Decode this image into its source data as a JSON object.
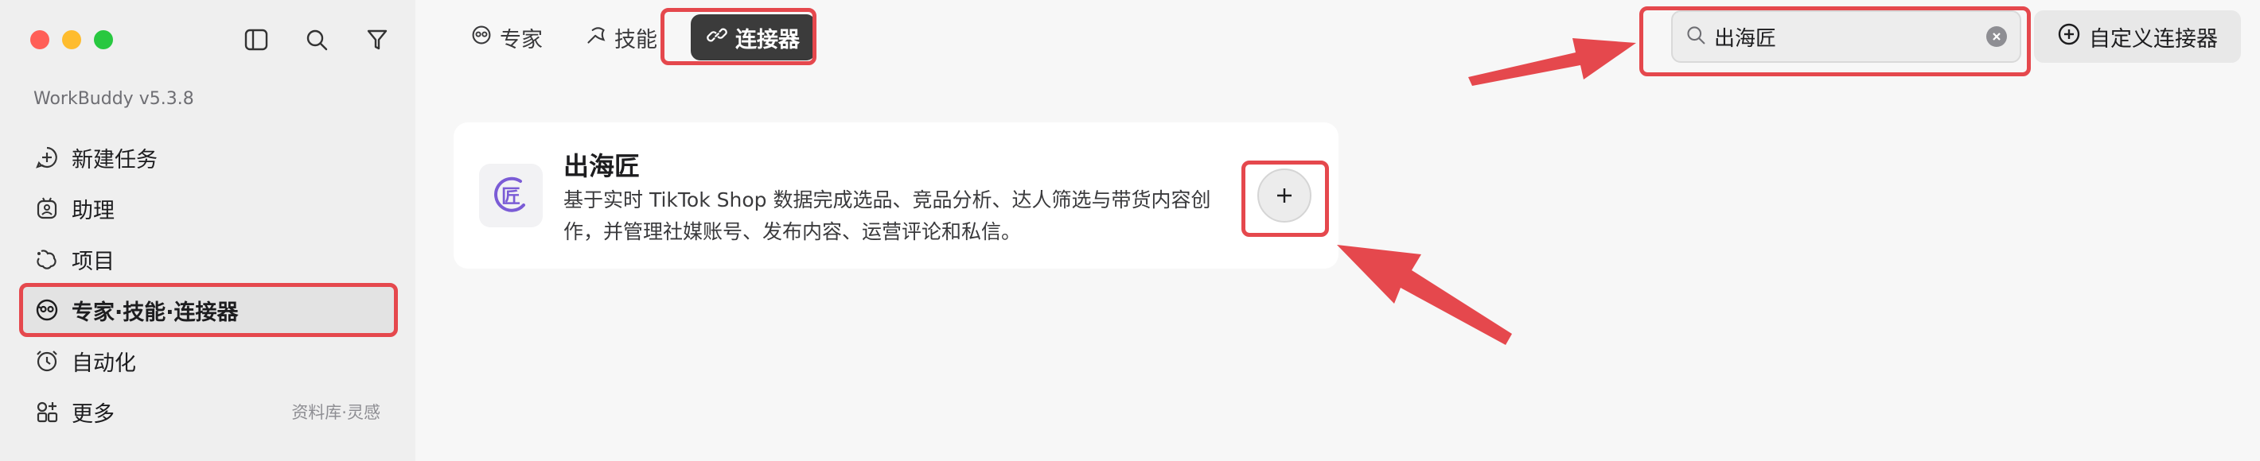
{
  "app": {
    "version": "WorkBuddy v5.3.8"
  },
  "window_controls": {
    "close": "#ff5f57",
    "minimize": "#febc2e",
    "zoom": "#28c840"
  },
  "sidebar": {
    "tools": [
      "sidebar-toggle-icon",
      "search-icon",
      "filter-icon"
    ],
    "items": [
      {
        "label": "新建任务",
        "icon": "new-task-icon"
      },
      {
        "label": "助理",
        "icon": "assistant-icon"
      },
      {
        "label": "项目",
        "icon": "project-icon"
      },
      {
        "label": "专家·技能·连接器",
        "icon": "expert-icon",
        "active": true
      },
      {
        "label": "自动化",
        "icon": "alarm-icon"
      },
      {
        "label": "更多",
        "icon": "more-icon",
        "extra": "资料库·灵感"
      }
    ]
  },
  "tabs": [
    {
      "label": "专家",
      "icon": "expert-icon"
    },
    {
      "label": "技能",
      "icon": "skill-icon"
    },
    {
      "label": "连接器",
      "icon": "link-icon",
      "active": true
    }
  ],
  "search": {
    "value": "出海匠",
    "placeholder": ""
  },
  "custom_connector": {
    "label": "自定义连接器"
  },
  "connector_card": {
    "name": "出海匠",
    "description": "基于实时 TikTok Shop 数据完成选品、竞品分析、达人筛选与带货内容创作，并管理社媒账号、发布内容、运营评论和私信。",
    "logo_char": "匠"
  },
  "colors": {
    "highlight": "#e5484d",
    "active_tab": "#3b3b3b",
    "logo_purple": "#7b5cd6"
  }
}
